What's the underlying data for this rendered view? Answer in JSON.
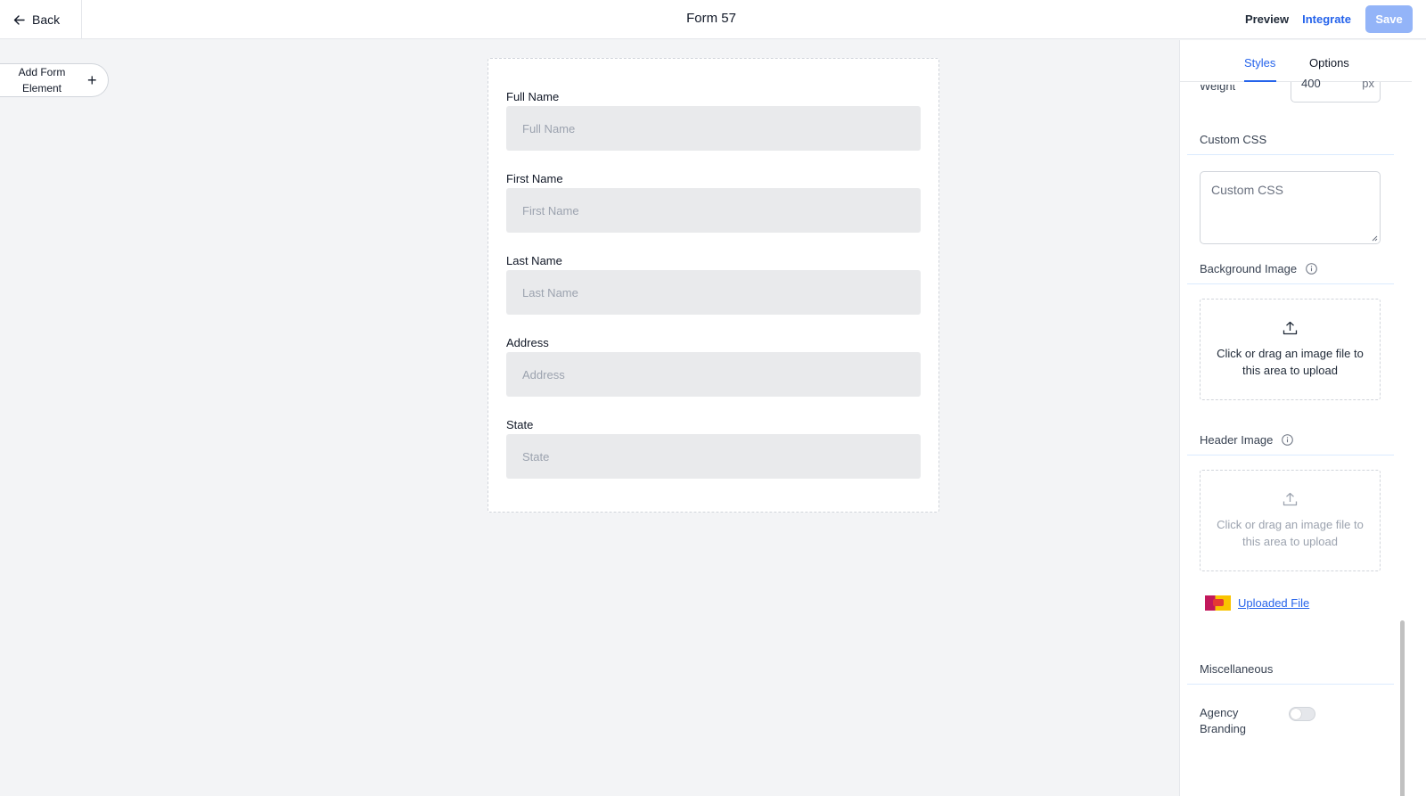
{
  "header": {
    "back_label": "Back",
    "title": "Form 57",
    "preview_label": "Preview",
    "integrate_label": "Integrate",
    "save_label": "Save"
  },
  "add_element": {
    "label": "Add Form Element",
    "plus": "+"
  },
  "form": {
    "fields": [
      {
        "label": "Full Name",
        "placeholder": "Full Name"
      },
      {
        "label": "First Name",
        "placeholder": "First Name"
      },
      {
        "label": "Last Name",
        "placeholder": "Last Name"
      },
      {
        "label": "Address",
        "placeholder": "Address"
      },
      {
        "label": "State",
        "placeholder": "State"
      }
    ]
  },
  "panel": {
    "tabs": [
      {
        "label": "Styles",
        "active": true
      },
      {
        "label": "Options",
        "active": false
      }
    ],
    "weight": {
      "label": "Weight",
      "value": "400",
      "unit": "px"
    },
    "custom_css": {
      "title": "Custom CSS",
      "placeholder": "Custom CSS"
    },
    "background_image": {
      "title": "Background Image",
      "upload_text": "Click or drag an image file to this area to upload"
    },
    "header_image": {
      "title": "Header Image",
      "upload_text": "Click or drag an image file to this area to upload",
      "uploaded_link": "Uploaded File"
    },
    "miscellaneous": {
      "title": "Miscellaneous",
      "agency_branding_label": "Agency Branding",
      "agency_branding_on": false
    }
  },
  "colors": {
    "accent": "#2563eb",
    "save_button": "#93b4f8",
    "canvas_bg": "#f3f4f6",
    "input_bg": "#e9eaec"
  },
  "icons": [
    "arrow-left-icon",
    "plus-icon",
    "info-icon",
    "upload-icon"
  ]
}
